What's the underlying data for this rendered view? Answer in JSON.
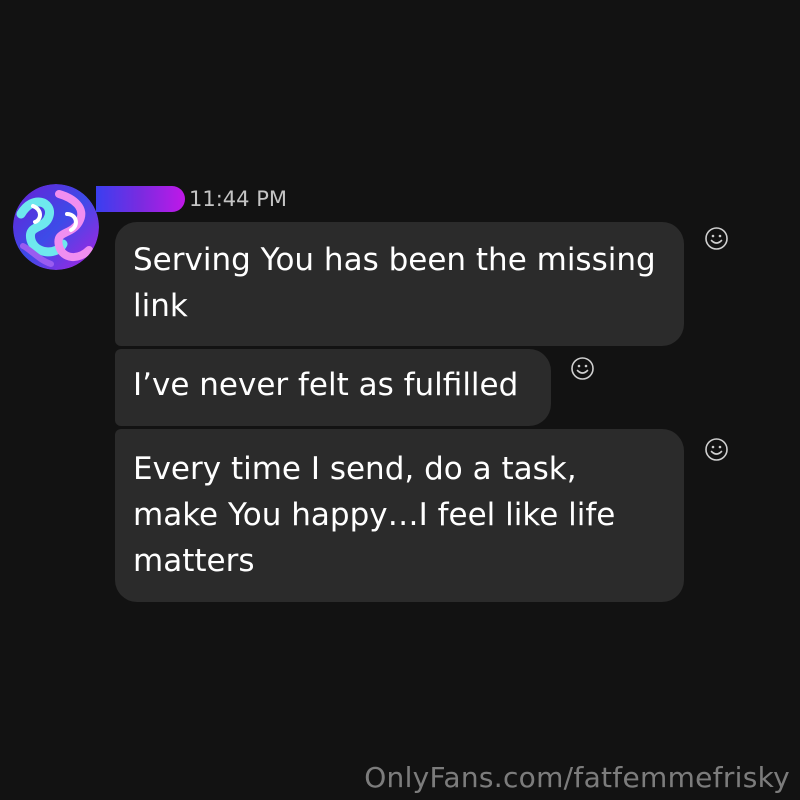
{
  "message": {
    "timestamp": "11:44 PM",
    "sender_name_redacted": true,
    "bubbles": [
      {
        "text": "Serving You has been the missing link"
      },
      {
        "text": "I’ve never felt as fulfilled"
      },
      {
        "text": "Every time I send, do a task, make You happy…I feel like life matters"
      }
    ]
  },
  "icons": {
    "avatar": "avatar",
    "reaction": "smiley-reaction-icon"
  },
  "colors": {
    "background": "#121212",
    "bubble": "#2b2b2b",
    "name_bar_gradient": [
      "#3a3ff0",
      "#7a2be0",
      "#c018e8"
    ],
    "timestamp": "#c4c4c4"
  },
  "watermark": "OnlyFans.com/fatfemmefrisky"
}
